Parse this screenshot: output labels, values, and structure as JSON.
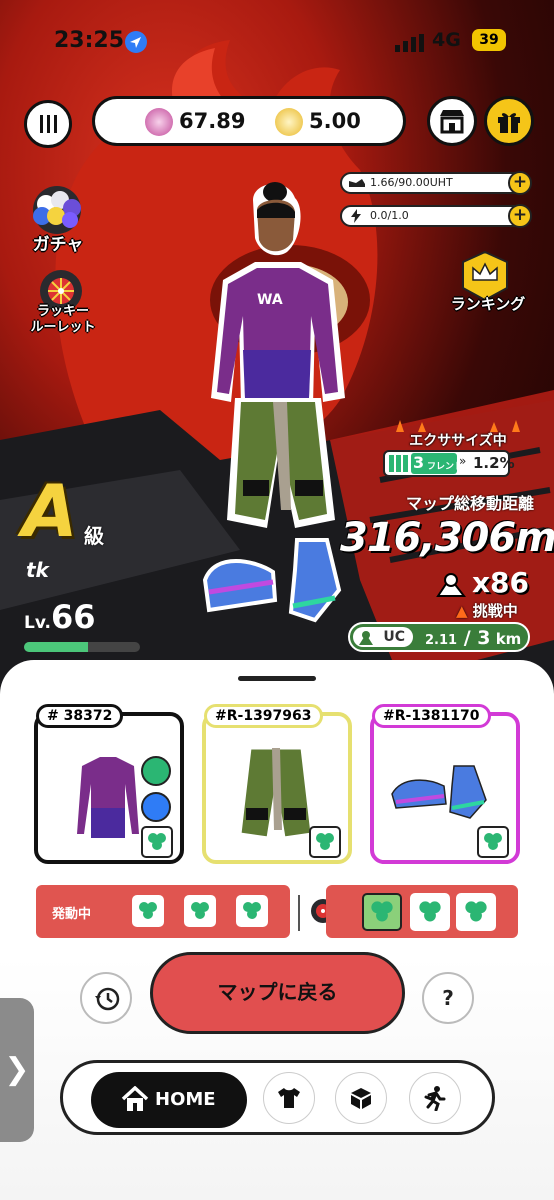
{
  "status_bar": {
    "time": "23:25",
    "network": "4G",
    "battery": "39"
  },
  "currency": {
    "gem": "67.89",
    "coin": "5.00"
  },
  "stats": {
    "energy": "1.66/90.00UHT",
    "power": "0.0/1.0"
  },
  "side_menu": {
    "gacha": "ガチャ",
    "roulette_line1": "ラッキー",
    "roulette_line2": "ルーレット",
    "ranking": "ランキング"
  },
  "exercise": {
    "label": "エクササイズ中",
    "friends_num": "3",
    "friends_unit": "フレンド",
    "bonus": "1.2%"
  },
  "distance": {
    "label": "マップ総移動距離",
    "value": "316,306m",
    "multiplier": "x86",
    "challenge": "挑戦中"
  },
  "uc": {
    "label": "UC",
    "current": "2.11",
    "sep": " / ",
    "target": "3",
    "unit": " km"
  },
  "profile": {
    "grade": "A",
    "grade_suffix": "級",
    "username": "tk",
    "level_prefix": "Lv.",
    "level": "66",
    "level_progress": 0.55
  },
  "cards": [
    {
      "tag": "# 38372",
      "color": "#111111"
    },
    {
      "tag": "#R-1397963",
      "color": "#e6e070"
    },
    {
      "tag": "#R-1381170",
      "color": "#d23ad6"
    }
  ],
  "active": {
    "label": "発動中"
  },
  "buttons": {
    "map": "マップに戻る",
    "help": "?"
  },
  "nav": {
    "home": "HOME"
  },
  "side_tab": "❯"
}
